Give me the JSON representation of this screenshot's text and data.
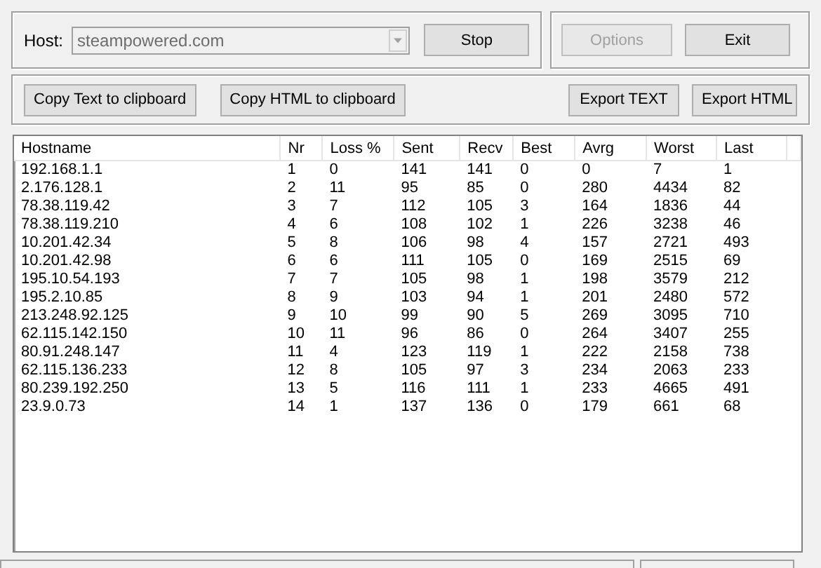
{
  "host": {
    "label": "Host:",
    "value": "steampowered.com",
    "disabled": true
  },
  "buttons_top": [
    {
      "label": "Stop",
      "disabled": false
    }
  ],
  "buttons_right": [
    {
      "label": "Options",
      "disabled": true
    },
    {
      "label": "Exit",
      "disabled": false
    }
  ],
  "buttons_copy": [
    {
      "label": "Copy Text to clipboard",
      "disabled": false
    },
    {
      "label": "Copy HTML to clipboard",
      "disabled": false
    }
  ],
  "buttons_export": [
    {
      "label": "Export TEXT",
      "disabled": false
    },
    {
      "label": "Export HTML",
      "disabled": false
    }
  ],
  "table": {
    "columns": [
      "Hostname",
      "Nr",
      "Loss %",
      "Sent",
      "Recv",
      "Best",
      "Avrg",
      "Worst",
      "Last"
    ],
    "rows": [
      [
        "192.168.1.1",
        "1",
        "0",
        "141",
        "141",
        "0",
        "0",
        "7",
        "1"
      ],
      [
        "2.176.128.1",
        "2",
        "11",
        "95",
        "85",
        "0",
        "280",
        "4434",
        "82"
      ],
      [
        "78.38.119.42",
        "3",
        "7",
        "112",
        "105",
        "3",
        "164",
        "1836",
        "44"
      ],
      [
        "78.38.119.210",
        "4",
        "6",
        "108",
        "102",
        "1",
        "226",
        "3238",
        "46"
      ],
      [
        "10.201.42.34",
        "5",
        "8",
        "106",
        "98",
        "4",
        "157",
        "2721",
        "493"
      ],
      [
        "10.201.42.98",
        "6",
        "6",
        "111",
        "105",
        "0",
        "169",
        "2515",
        "69"
      ],
      [
        "195.10.54.193",
        "7",
        "7",
        "105",
        "98",
        "1",
        "198",
        "3579",
        "212"
      ],
      [
        "195.2.10.85",
        "8",
        "9",
        "103",
        "94",
        "1",
        "201",
        "2480",
        "572"
      ],
      [
        "213.248.92.125",
        "9",
        "10",
        "99",
        "90",
        "5",
        "269",
        "3095",
        "710"
      ],
      [
        "62.115.142.150",
        "10",
        "11",
        "96",
        "86",
        "0",
        "264",
        "3407",
        "255"
      ],
      [
        "80.91.248.147",
        "11",
        "4",
        "123",
        "119",
        "1",
        "222",
        "2158",
        "738"
      ],
      [
        "62.115.136.233",
        "12",
        "8",
        "105",
        "97",
        "3",
        "234",
        "2063",
        "233"
      ],
      [
        "80.239.192.250",
        "13",
        "5",
        "116",
        "111",
        "1",
        "233",
        "4665",
        "491"
      ],
      [
        "23.9.0.73",
        "14",
        "1",
        "137",
        "136",
        "0",
        "179",
        "661",
        "68"
      ]
    ]
  }
}
